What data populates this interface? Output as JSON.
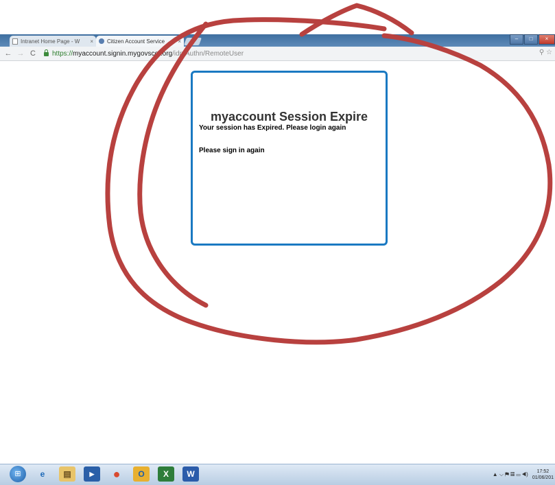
{
  "browser": {
    "tabs": [
      {
        "label": "Intranet Home Page - W",
        "close": "×"
      },
      {
        "label": "Citizen Account Service",
        "close": "×"
      }
    ],
    "url": {
      "scheme": "https://",
      "host": "myaccount.signin.mygovscot.org",
      "path": "/idp/Authn/RemoteUser"
    },
    "nav": {
      "back": "←",
      "forward": "→",
      "reload": "C"
    },
    "window_buttons": {
      "minimize": "–",
      "maximize": "□",
      "close": "×"
    },
    "right_icons": "⚲ ☆"
  },
  "dialog": {
    "title": "myaccount Session Expire",
    "message": "Your session has Expired. Please login again",
    "sign_in": "Please sign in again"
  },
  "taskbar": {
    "apps": [
      {
        "icon": "internet-explorer-icon",
        "glyph": "e"
      },
      {
        "icon": "file-explorer-icon",
        "glyph": "▤"
      },
      {
        "icon": "media-player-icon",
        "glyph": "▶"
      },
      {
        "icon": "chrome-icon",
        "glyph": "●"
      },
      {
        "icon": "outlook-icon",
        "glyph": "O"
      },
      {
        "icon": "excel-icon",
        "glyph": "X"
      },
      {
        "icon": "word-icon",
        "glyph": "W"
      }
    ],
    "tray_icons": "▲ ⌵ ⚑ ▦ ▭ ◀)",
    "time": "17:52",
    "date": "01/06/201"
  },
  "colors": {
    "annotation": "#b8413f",
    "dialog_border": "#1a79c2"
  }
}
